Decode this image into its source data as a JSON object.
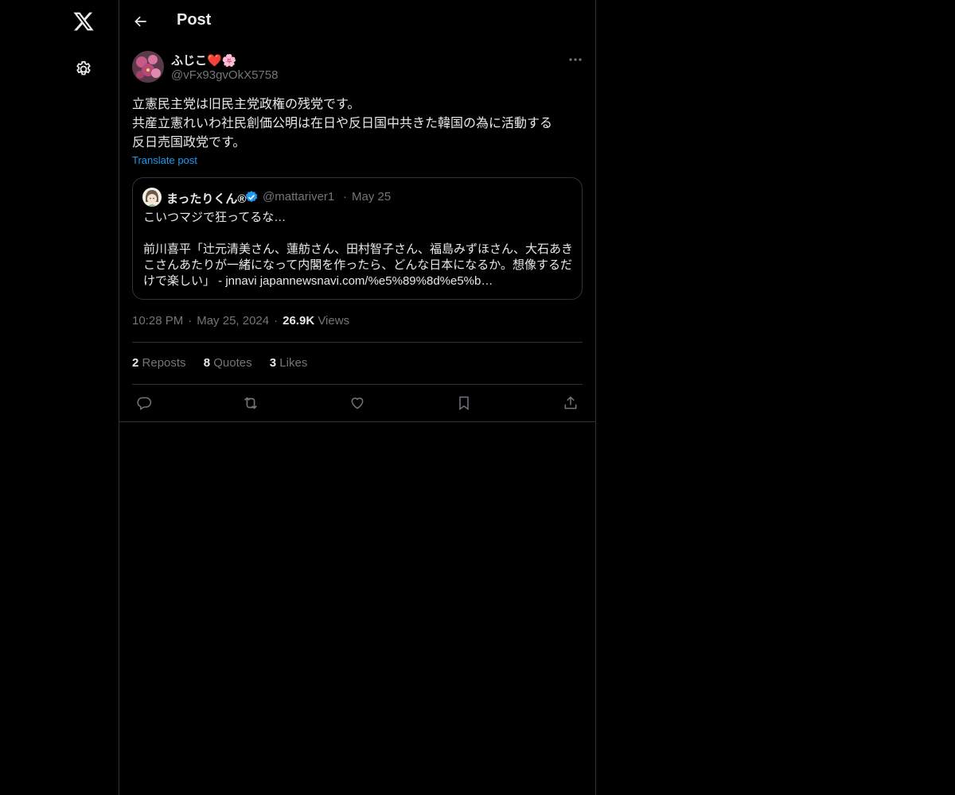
{
  "nav": {
    "logo_icon": "x-logo-icon",
    "settings_icon": "gear-icon"
  },
  "header": {
    "title": "Post",
    "back_icon": "arrow-left-icon"
  },
  "post": {
    "author_name": "ふじこ❤️🌸",
    "author_handle": "@vFx93gvOkX5758",
    "text_lines": [
      "立憲民主党は旧民主党政権の残党です。",
      "共産立憲れいわ社民創価公明は在日や反日国中共きた韓国の為に活動する",
      "反日売国政党です。"
    ],
    "translate_label": "Translate post",
    "quote": {
      "author_name": "まったりくん®",
      "author_handle": "@mattariver1",
      "separator": "·",
      "date": "May 25",
      "line1": "こいつマジで狂ってるな…",
      "line2": "前川喜平「辻元清美さん、蓮舫さん、田村智子さん、福島みずほさん、大石あきこさんあたりが一緒になって内閣を作ったら、どんな日本になるか。想像するだけで楽しい」 - jnnavi japannewsnavi.com/%e5%89%8d%e5%b…"
    },
    "time": "10:28 PM",
    "separator": "·",
    "date": "May 25, 2024",
    "views_count": "26.9K",
    "views_label": "Views",
    "stats": {
      "reposts_count": "2",
      "reposts_label": "Reposts",
      "quotes_count": "8",
      "quotes_label": "Quotes",
      "likes_count": "3",
      "likes_label": "Likes"
    },
    "actions": [
      "reply-icon",
      "repost-icon",
      "like-icon",
      "bookmark-icon",
      "share-icon"
    ]
  },
  "colors": {
    "background": "#000000",
    "text": "#e7e9ea",
    "muted": "#71767b",
    "accent": "#1d9bf0",
    "border": "#2f3336",
    "verified": "#1d9bf0"
  }
}
